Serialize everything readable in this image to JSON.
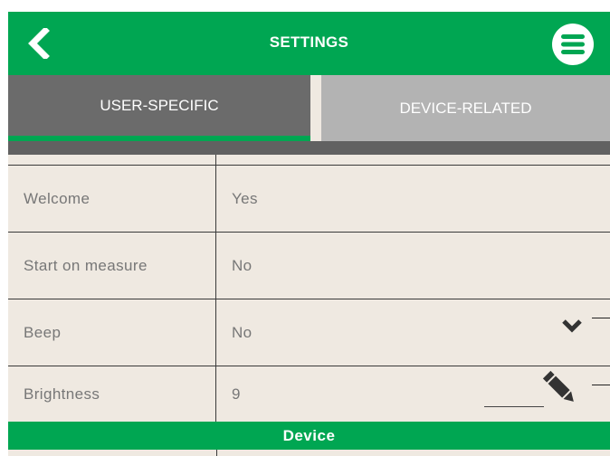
{
  "header": {
    "title": "SETTINGS",
    "back_icon": "chevron-left-icon",
    "menu_icon": "hamburger-menu-icon"
  },
  "tabs": [
    {
      "label": "USER-SPECIFIC",
      "active": true
    },
    {
      "label": "DEVICE-RELATED",
      "active": false
    }
  ],
  "settings": [
    {
      "label": "Welcome",
      "value": "Yes"
    },
    {
      "label": "Start on measure",
      "value": "No"
    },
    {
      "label": "Beep",
      "value": "No",
      "control": "chevron-down-icon"
    },
    {
      "label": "Brightness",
      "value": "9",
      "control": "pencil-icon"
    }
  ],
  "section": {
    "title": "Device"
  },
  "colors": {
    "brand_green": "#00a652",
    "tab_active": "#6b6b6b",
    "tab_inactive": "#b3b3b3",
    "background": "#efe9e1",
    "text_muted": "#777777"
  }
}
